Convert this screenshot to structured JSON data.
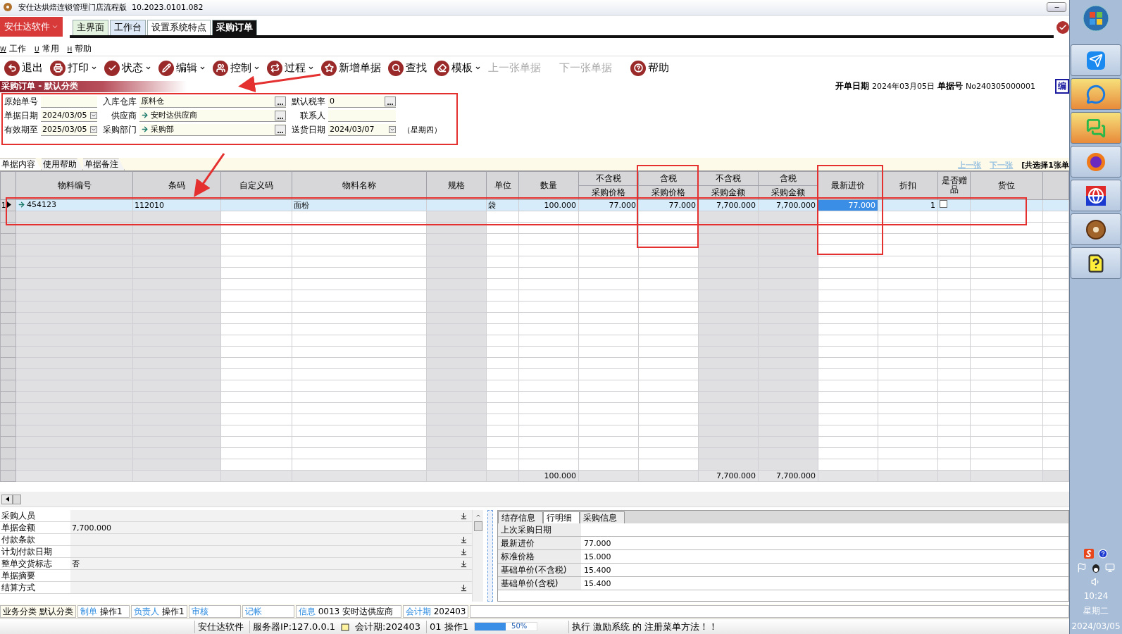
{
  "window": {
    "title": "安仕达烘焙连锁管理门店流程版  10.2023.0101.082"
  },
  "app_menu": {
    "label": "安仕达软件"
  },
  "tabs": [
    {
      "label": "主界面",
      "selected": false
    },
    {
      "label": "工作台",
      "selected": false
    },
    {
      "label": "设置系统特点",
      "selected": false
    },
    {
      "label": "采购订单",
      "selected": true
    }
  ],
  "menu": [
    {
      "hotkey": "W",
      "label": "工作"
    },
    {
      "hotkey": "U",
      "label": "常用"
    },
    {
      "hotkey": "H",
      "label": "帮助"
    }
  ],
  "toolbar": [
    {
      "label": "退出",
      "dropdown": false,
      "disabled": false
    },
    {
      "label": "打印",
      "dropdown": true,
      "disabled": false
    },
    {
      "label": "状态",
      "dropdown": true,
      "disabled": false
    },
    {
      "label": "编辑",
      "dropdown": true,
      "disabled": false
    },
    {
      "label": "控制",
      "dropdown": true,
      "disabled": false
    },
    {
      "label": "过程",
      "dropdown": true,
      "disabled": false
    },
    {
      "label": "新增单据",
      "dropdown": false,
      "disabled": false
    },
    {
      "label": "查找",
      "dropdown": false,
      "disabled": false
    },
    {
      "label": "模板",
      "dropdown": true,
      "disabled": false
    },
    {
      "label": "上一张单据",
      "dropdown": false,
      "disabled": true
    },
    {
      "label": "下一张单据",
      "dropdown": false,
      "disabled": true
    },
    {
      "label": "帮助",
      "dropdown": false,
      "disabled": false
    }
  ],
  "section": {
    "title": "采购订单 - 默认分类"
  },
  "doc_info": {
    "date_label": "开单日期",
    "date": "2024年03月05日",
    "number_label": "单据号",
    "number": "No240305000001",
    "badge": "编"
  },
  "form": [
    [
      {
        "label": "原始单号",
        "kind": "text"
      },
      {
        "label": "单据日期",
        "kind": "date",
        "value": "2024/03/05"
      },
      {
        "label": "有效期至",
        "kind": "date",
        "value": "2025/03/05"
      }
    ],
    [
      {
        "label": "入库仓库",
        "kind": "lookup",
        "value": "原料仓",
        "linked": false
      },
      {
        "label": "供应商",
        "kind": "lookup",
        "value": "安时达供应商",
        "linked": true
      },
      {
        "label": "采购部门",
        "kind": "lookup",
        "value": "采购部",
        "linked": true
      }
    ],
    [
      {
        "label": "默认税率",
        "kind": "lookup",
        "value": "0",
        "linked": false
      },
      {
        "label": "联系人",
        "kind": "text"
      },
      {
        "label": "送货日期",
        "kind": "date",
        "value": "2024/03/07",
        "note": "（星期四）"
      }
    ]
  ],
  "sub_tabs": [
    {
      "label": "单据内容",
      "selected": true
    },
    {
      "label": "使用帮助",
      "selected": false
    },
    {
      "label": "单据备注",
      "selected": false
    }
  ],
  "record_nav": {
    "prev": "上一张",
    "next": "下一张",
    "disabled": true,
    "summary": "[共选择1张单"
  },
  "table": {
    "columns": [
      {
        "label": "物料编号",
        "kind": "text",
        "readonly": true
      },
      {
        "label": "条码",
        "kind": "text",
        "readonly": true
      },
      {
        "label": "自定义码",
        "kind": "text",
        "readonly": false
      },
      {
        "label": "物料名称",
        "kind": "text",
        "readonly": false
      },
      {
        "label": "规格",
        "kind": "text",
        "readonly": true
      },
      {
        "label": "单位",
        "kind": "text",
        "readonly": false
      },
      {
        "label": "数量",
        "kind": "number",
        "readonly": false,
        "total": "100.000"
      },
      {
        "top": "不含税",
        "label": "采购价格",
        "kind": "number",
        "readonly": false
      },
      {
        "top": "含税",
        "label": "采购价格",
        "kind": "number",
        "readonly": false
      },
      {
        "top": "不含税",
        "label": "采购金额",
        "kind": "number",
        "readonly": true,
        "total": "7,700.000"
      },
      {
        "top": "含税",
        "label": "采购金额",
        "kind": "number",
        "readonly": true,
        "total": "7,700.000"
      },
      {
        "label": "最新进价",
        "kind": "number",
        "readonly": false
      },
      {
        "label": "折扣",
        "kind": "number",
        "readonly": false
      },
      {
        "label": "是否赠品",
        "kind": "check",
        "readonly": false
      },
      {
        "label": "货位",
        "kind": "text",
        "readonly": false
      }
    ],
    "rows": [
      {
        "number": "1",
        "selected": true,
        "cells": [
          {
            "text": "454123",
            "focused": false
          },
          {
            "text": "112010",
            "focused": false
          },
          {
            "focused": false
          },
          {
            "text": "面粉",
            "focused": false
          },
          {
            "focused": false
          },
          {
            "text": "袋",
            "focused": false
          },
          {
            "text": "100.000",
            "focused": false
          },
          {
            "text": "77.000",
            "focused": false
          },
          {
            "text": "77.000",
            "focused": false
          },
          {
            "text": "7,700.000",
            "focused": false
          },
          {
            "text": "7,700.000",
            "focused": false
          },
          {
            "text": "77.000",
            "focused": true
          },
          {
            "text": "1",
            "focused": false
          },
          {
            "checked": false,
            "focused": false
          },
          {
            "focused": false
          }
        ]
      }
    ],
    "selectable": true
  },
  "properties": [
    {
      "label": "采购人员",
      "dropdown": true
    },
    {
      "label": "单据金额",
      "value": "7,700.000",
      "dropdown": false
    },
    {
      "label": "付款条款",
      "dropdown": true
    },
    {
      "label": "计划付款日期",
      "dropdown": true
    },
    {
      "label": "整单交货标志",
      "value": "否",
      "dropdown": true
    },
    {
      "label": "单据摘要",
      "dropdown": false
    },
    {
      "label": "结算方式",
      "dropdown": true
    }
  ],
  "detail_tabs": [
    {
      "label": "结存信息",
      "selected": false
    },
    {
      "label": "行明细",
      "selected": true
    },
    {
      "label": "采购信息",
      "selected": false
    }
  ],
  "details": [
    {
      "label": "上次采购日期"
    },
    {
      "label": "最新进价",
      "value": "77.000"
    },
    {
      "label": "标准价格",
      "value": "15.000"
    },
    {
      "label": "基础单价(不含税)",
      "value": "15.400"
    },
    {
      "label": "基础单价(含税)",
      "value": "15.400"
    }
  ],
  "info_bar": [
    {
      "label": "业务分类",
      "value": "默认分类",
      "highlight": false
    },
    {
      "label": "制单",
      "value": "操作1",
      "highlight": true
    },
    {
      "label": "负责人",
      "value": "操作1",
      "highlight": true
    },
    {
      "label": "审核",
      "highlight": true
    },
    {
      "label": "记帐",
      "highlight": true
    },
    {
      "label": "信息",
      "value": "0013 安时达供应商",
      "highlight": true
    },
    {
      "label": "会计期",
      "value": "202403",
      "highlight": true
    }
  ],
  "status_bar": {
    "company": "安仕达软件",
    "server": "服务器IP:127.0.0.1",
    "period": "会计期:202403",
    "user": "01 操作1",
    "progress": {
      "level": 0.5,
      "reading": "50%"
    },
    "message": "执行 激励系统 的 注册菜单方法！！"
  },
  "taskbar": {
    "time": "10:24",
    "weekday": "星期二",
    "date": "2024/03/05"
  }
}
